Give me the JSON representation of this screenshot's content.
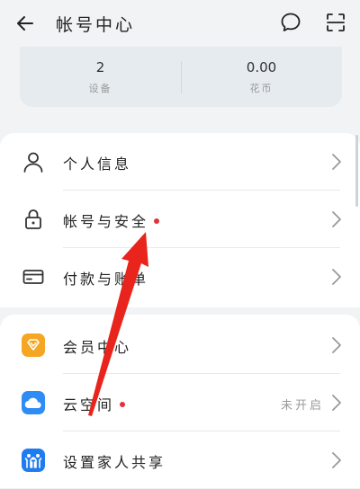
{
  "header": {
    "title": "帐号中心",
    "icons": {
      "back": "arrow-left-icon",
      "message": "message-bubble-icon",
      "scan": "scan-icon"
    }
  },
  "stats": {
    "devices": {
      "value": "2",
      "label": "设备"
    },
    "coins": {
      "value": "0.00",
      "label": "花币"
    }
  },
  "section1": {
    "items": [
      {
        "label": "个人信息",
        "icon": "person-icon"
      },
      {
        "label": "帐号与安全",
        "icon": "lock-icon",
        "badge": true
      },
      {
        "label": "付款与账单",
        "icon": "card-icon"
      }
    ]
  },
  "section2": {
    "items": [
      {
        "label": "会员中心",
        "icon": "vip-heart-icon",
        "icon_color": "#f5a623"
      },
      {
        "label": "云空间",
        "icon": "cloud-icon",
        "icon_color": "#2f8cf5",
        "badge": true,
        "status": "未开启"
      },
      {
        "label": "设置家人共享",
        "icon": "family-share-icon",
        "icon_color": "#1f7bf0"
      }
    ]
  },
  "colors": {
    "accent_red": "#e0323a",
    "annotation_arrow": "#e8241c"
  }
}
